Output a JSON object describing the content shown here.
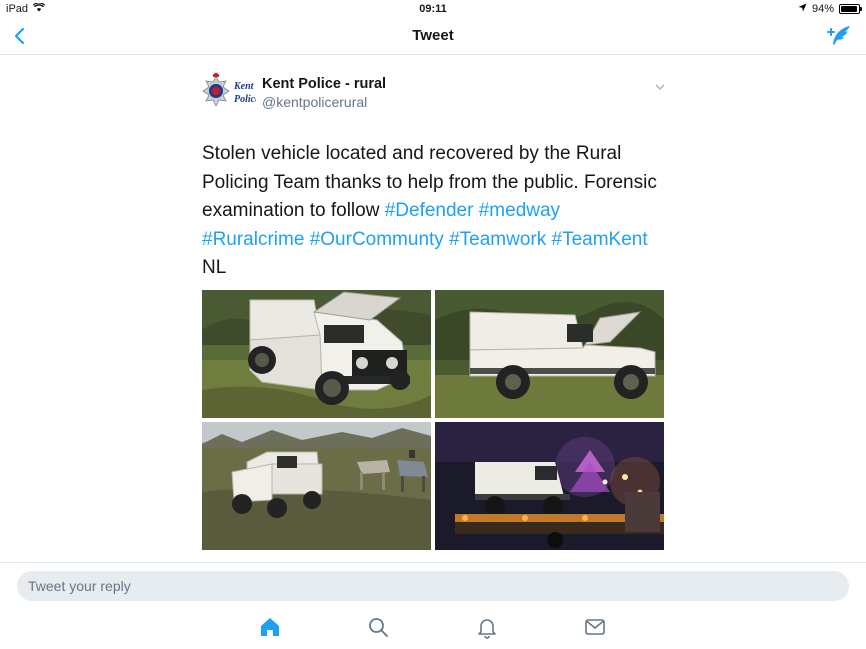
{
  "status_bar": {
    "device": "iPad",
    "time": "09:11",
    "battery_text": "94%",
    "battery_level": 0.94
  },
  "nav": {
    "title": "Tweet",
    "back_icon": "chevron-left-icon",
    "compose_icon": "compose-tweet-icon",
    "accent_color": "#1da1f2"
  },
  "tweet": {
    "author_name": "Kent Police - rural",
    "author_handle": "@kentpolicerural",
    "avatar_text_line1": "Kent",
    "avatar_text_line2": "Police",
    "text_plain": "Stolen vehicle located and recovered by the Rural Policing Team thanks to help from the public. Forensic examination to follow ",
    "hashtags": [
      "#Defender",
      "#medway",
      "#Ruralcrime",
      "#OurCommunty",
      "#Teamwork",
      "#TeamKent"
    ],
    "signoff": "NL",
    "photos": [
      "photo-defender-front-hood-open",
      "photo-defender-side-hood-open",
      "photo-defender-with-horses",
      "photo-defender-on-recovery-truck-night"
    ]
  },
  "reply": {
    "placeholder": "Tweet your reply"
  },
  "tabbar": {
    "items": [
      "home-icon",
      "search-icon",
      "notifications-icon",
      "messages-icon"
    ],
    "active": "home-icon"
  }
}
